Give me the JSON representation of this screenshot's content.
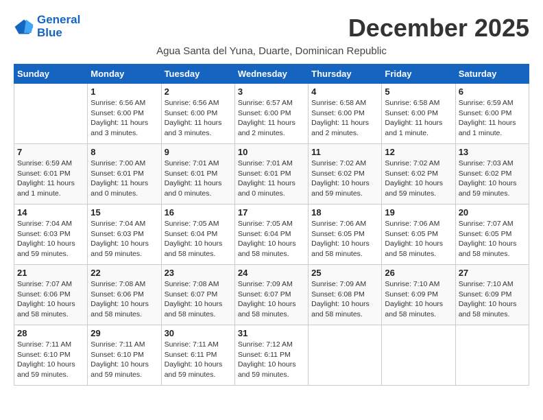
{
  "logo": {
    "line1": "General",
    "line2": "Blue"
  },
  "title": "December 2025",
  "subtitle": "Agua Santa del Yuna, Duarte, Dominican Republic",
  "weekdays": [
    "Sunday",
    "Monday",
    "Tuesday",
    "Wednesday",
    "Thursday",
    "Friday",
    "Saturday"
  ],
  "weeks": [
    [
      {
        "day": "",
        "info": ""
      },
      {
        "day": "1",
        "info": "Sunrise: 6:56 AM\nSunset: 6:00 PM\nDaylight: 11 hours\nand 3 minutes."
      },
      {
        "day": "2",
        "info": "Sunrise: 6:56 AM\nSunset: 6:00 PM\nDaylight: 11 hours\nand 3 minutes."
      },
      {
        "day": "3",
        "info": "Sunrise: 6:57 AM\nSunset: 6:00 PM\nDaylight: 11 hours\nand 2 minutes."
      },
      {
        "day": "4",
        "info": "Sunrise: 6:58 AM\nSunset: 6:00 PM\nDaylight: 11 hours\nand 2 minutes."
      },
      {
        "day": "5",
        "info": "Sunrise: 6:58 AM\nSunset: 6:00 PM\nDaylight: 11 hours\nand 1 minute."
      },
      {
        "day": "6",
        "info": "Sunrise: 6:59 AM\nSunset: 6:00 PM\nDaylight: 11 hours\nand 1 minute."
      }
    ],
    [
      {
        "day": "7",
        "info": "Sunrise: 6:59 AM\nSunset: 6:01 PM\nDaylight: 11 hours\nand 1 minute."
      },
      {
        "day": "8",
        "info": "Sunrise: 7:00 AM\nSunset: 6:01 PM\nDaylight: 11 hours\nand 0 minutes."
      },
      {
        "day": "9",
        "info": "Sunrise: 7:01 AM\nSunset: 6:01 PM\nDaylight: 11 hours\nand 0 minutes."
      },
      {
        "day": "10",
        "info": "Sunrise: 7:01 AM\nSunset: 6:01 PM\nDaylight: 11 hours\nand 0 minutes."
      },
      {
        "day": "11",
        "info": "Sunrise: 7:02 AM\nSunset: 6:02 PM\nDaylight: 10 hours\nand 59 minutes."
      },
      {
        "day": "12",
        "info": "Sunrise: 7:02 AM\nSunset: 6:02 PM\nDaylight: 10 hours\nand 59 minutes."
      },
      {
        "day": "13",
        "info": "Sunrise: 7:03 AM\nSunset: 6:02 PM\nDaylight: 10 hours\nand 59 minutes."
      }
    ],
    [
      {
        "day": "14",
        "info": "Sunrise: 7:04 AM\nSunset: 6:03 PM\nDaylight: 10 hours\nand 59 minutes."
      },
      {
        "day": "15",
        "info": "Sunrise: 7:04 AM\nSunset: 6:03 PM\nDaylight: 10 hours\nand 59 minutes."
      },
      {
        "day": "16",
        "info": "Sunrise: 7:05 AM\nSunset: 6:04 PM\nDaylight: 10 hours\nand 58 minutes."
      },
      {
        "day": "17",
        "info": "Sunrise: 7:05 AM\nSunset: 6:04 PM\nDaylight: 10 hours\nand 58 minutes."
      },
      {
        "day": "18",
        "info": "Sunrise: 7:06 AM\nSunset: 6:05 PM\nDaylight: 10 hours\nand 58 minutes."
      },
      {
        "day": "19",
        "info": "Sunrise: 7:06 AM\nSunset: 6:05 PM\nDaylight: 10 hours\nand 58 minutes."
      },
      {
        "day": "20",
        "info": "Sunrise: 7:07 AM\nSunset: 6:05 PM\nDaylight: 10 hours\nand 58 minutes."
      }
    ],
    [
      {
        "day": "21",
        "info": "Sunrise: 7:07 AM\nSunset: 6:06 PM\nDaylight: 10 hours\nand 58 minutes."
      },
      {
        "day": "22",
        "info": "Sunrise: 7:08 AM\nSunset: 6:06 PM\nDaylight: 10 hours\nand 58 minutes."
      },
      {
        "day": "23",
        "info": "Sunrise: 7:08 AM\nSunset: 6:07 PM\nDaylight: 10 hours\nand 58 minutes."
      },
      {
        "day": "24",
        "info": "Sunrise: 7:09 AM\nSunset: 6:07 PM\nDaylight: 10 hours\nand 58 minutes."
      },
      {
        "day": "25",
        "info": "Sunrise: 7:09 AM\nSunset: 6:08 PM\nDaylight: 10 hours\nand 58 minutes."
      },
      {
        "day": "26",
        "info": "Sunrise: 7:10 AM\nSunset: 6:09 PM\nDaylight: 10 hours\nand 58 minutes."
      },
      {
        "day": "27",
        "info": "Sunrise: 7:10 AM\nSunset: 6:09 PM\nDaylight: 10 hours\nand 58 minutes."
      }
    ],
    [
      {
        "day": "28",
        "info": "Sunrise: 7:11 AM\nSunset: 6:10 PM\nDaylight: 10 hours\nand 59 minutes."
      },
      {
        "day": "29",
        "info": "Sunrise: 7:11 AM\nSunset: 6:10 PM\nDaylight: 10 hours\nand 59 minutes."
      },
      {
        "day": "30",
        "info": "Sunrise: 7:11 AM\nSunset: 6:11 PM\nDaylight: 10 hours\nand 59 minutes."
      },
      {
        "day": "31",
        "info": "Sunrise: 7:12 AM\nSunset: 6:11 PM\nDaylight: 10 hours\nand 59 minutes."
      },
      {
        "day": "",
        "info": ""
      },
      {
        "day": "",
        "info": ""
      },
      {
        "day": "",
        "info": ""
      }
    ]
  ]
}
